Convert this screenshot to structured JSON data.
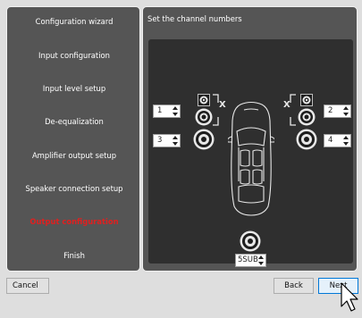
{
  "sidebar": {
    "steps": [
      {
        "label": "Configuration wizard",
        "active": false
      },
      {
        "label": "Input configuration",
        "active": false
      },
      {
        "label": "Input level setup",
        "active": false
      },
      {
        "label": "De-equalization",
        "active": false
      },
      {
        "label": "Amplifier output setup",
        "active": false
      },
      {
        "label": "Speaker connection setup",
        "active": false
      },
      {
        "label": "Output configuration",
        "active": true
      },
      {
        "label": "Finish",
        "active": false
      }
    ]
  },
  "main": {
    "title": "Set the channel numbers",
    "channels": {
      "front_left": "1",
      "rear_left": "3",
      "front_right": "2",
      "rear_right": "4",
      "sub": "5SUB"
    },
    "bracket_marks": {
      "left": "X",
      "right": "X"
    }
  },
  "footer": {
    "cancel_label": "Cancel",
    "back_label": "Back",
    "next_label": "Next"
  },
  "colors": {
    "panel_bg": "#555555",
    "stage_bg": "#2f2f2f",
    "active_step": "#e02020",
    "next_border": "#0078d7"
  }
}
